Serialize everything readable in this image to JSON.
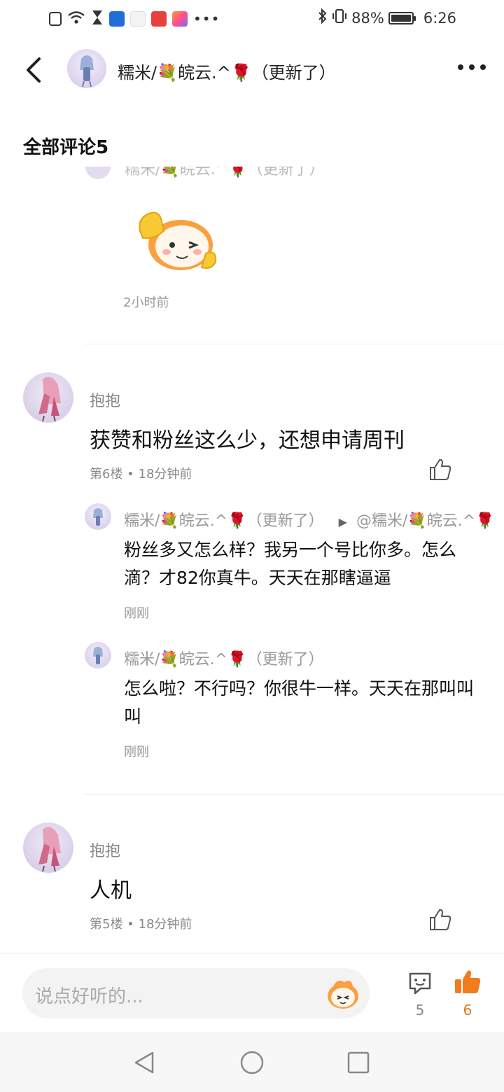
{
  "status_bar": {
    "battery": "88%",
    "time": "6:26"
  },
  "header": {
    "title": "糯米/💐皖云.^🌹（更新了）"
  },
  "section_title": "全部评论5",
  "partial_comment": {
    "ghost_name": "糯米/💐皖云.^🌹（更新了）",
    "time": "2小时前"
  },
  "comments": [
    {
      "username": "抱抱",
      "content": "获赞和粉丝这么少，还想申请周刊",
      "meta": "第6楼 • 18分钟前",
      "replies": [
        {
          "name": "糯米/💐皖云.^🌹（更新了）",
          "reply_to": "@糯米/💐皖云.^🌹",
          "text": "粉丝多又怎么样？我另一个号比你多。怎么滴？才82你真牛。天天在那瞎逼逼",
          "time": "刚刚"
        },
        {
          "name": "糯米/💐皖云.^🌹（更新了）",
          "reply_to": "",
          "text": "怎么啦？不行吗？你很牛一样。天天在那叫叫叫",
          "time": "刚刚"
        }
      ]
    },
    {
      "username": "抱抱",
      "content": "人机",
      "meta": "第5楼 • 18分钟前",
      "replies": []
    }
  ],
  "bottom_bar": {
    "input_placeholder": "说点好听的...",
    "comment_count": "5",
    "like_count": "6"
  },
  "colors": {
    "accent": "#f07c1e",
    "text_primary": "#111111",
    "text_secondary": "#888888"
  }
}
